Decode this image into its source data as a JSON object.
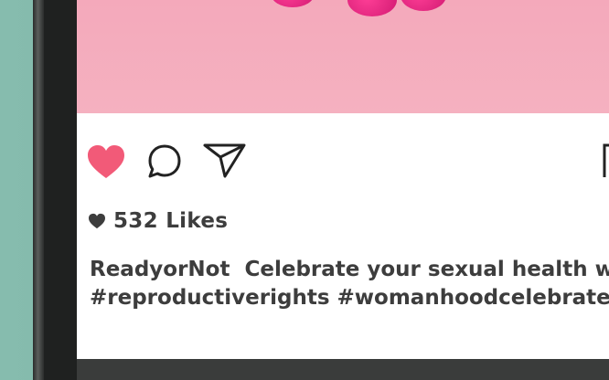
{
  "post": {
    "likes_label": "532 Likes",
    "caption_username": "ReadyorNot",
    "caption_text": "Celebrate your sexual health with",
    "caption_hashtags": "#reproductiverights #womanhoodcelebrated"
  },
  "actions": {
    "like_icon": "heart-filled-icon",
    "comment_icon": "comment-bubble-icon",
    "share_icon": "paper-plane-icon",
    "save_icon": "bookmark-icon"
  },
  "colors": {
    "like_active": "#f25a78",
    "text": "#3d3d3d",
    "image_bg": "#f4a9bb",
    "flower": "#e0227d"
  }
}
